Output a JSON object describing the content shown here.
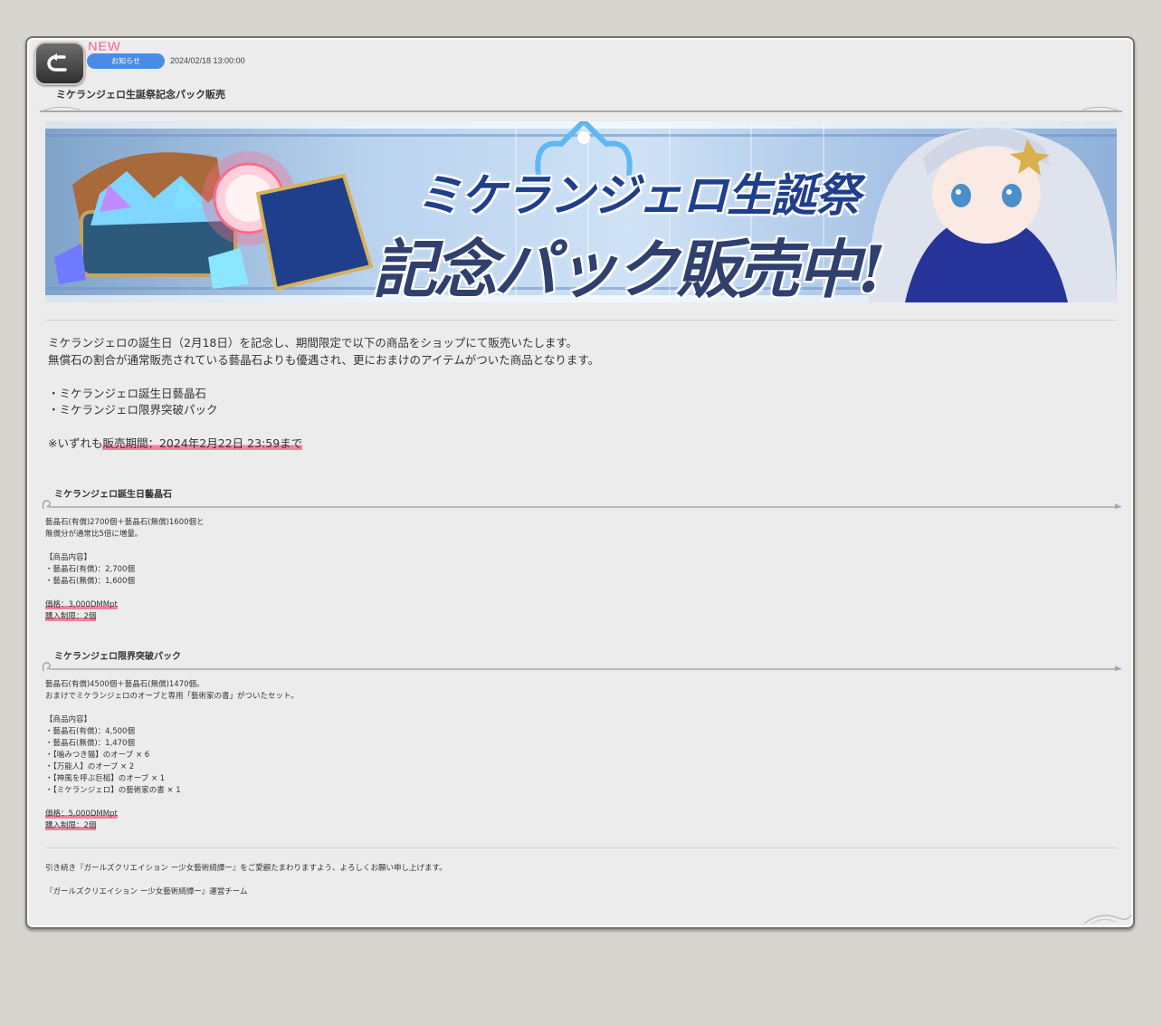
{
  "header": {
    "new_label": "NEW",
    "category": "お知らせ",
    "date": "2024/02/18 13:00:00",
    "title": "ミケランジェロ生誕祭記念パック販売"
  },
  "banner": {
    "line1": "ミケランジェロ生誕祭",
    "line2": "記念パック販売中!"
  },
  "intro": {
    "line1": "ミケランジェロの誕生日（2月18日）を記念し、期間限定で以下の商品をショップにて販売いたします。",
    "line2": "無償石の割合が通常販売されている藝晶石よりも優遇され、更におまけのアイテムがついた商品となります。",
    "items": [
      "・ミケランジェロ誕生日藝晶石",
      "・ミケランジェロ限界突破パック"
    ],
    "note_prefix": "※いずれも",
    "note_highlight": "販売期間：2024年2月22日 23:59まで"
  },
  "sections": [
    {
      "title": "ミケランジェロ誕生日藝晶石",
      "desc": [
        "藝晶石(有償)2700個＋藝晶石(無償)1600個と",
        "無償分が通常比5倍に増量。"
      ],
      "contents_header": "【商品内容】",
      "contents": [
        "・藝晶石(有償)：2,700個",
        "・藝晶石(無償)：1,600個"
      ],
      "price": "価格：3,000DMMpt",
      "limit": "購入制限：2個"
    },
    {
      "title": "ミケランジェロ限界突破パック",
      "desc": [
        "藝晶石(有償)4500個＋藝晶石(無償)1470個。",
        "おまけでミケランジェロのオーブと専用「藝術家の書」がついたセット。"
      ],
      "contents_header": "【商品内容】",
      "contents": [
        "・藝晶石(有償)：4,500個",
        "・藝晶石(無償)：1,470個",
        "・【噛みつき猫】のオーブ × 6",
        "・【万能人】のオーブ × 2",
        "・【神風を呼ぶ巨槌】のオーブ × 1",
        "・【ミケランジェロ】の藝術家の書 × 1"
      ],
      "price": "価格：5,000DMMpt",
      "limit": "購入制限：2個"
    }
  ],
  "footer": {
    "line1": "引き続き『ガールズクリエイション ー少女藝術綺譚ー』をご愛顧たまわりますよう、よろしくお願い申し上げます。",
    "line2": "『ガールズクリエイション ー少女藝術綺譚ー』運営チーム"
  },
  "colors": {
    "badge": "#4b8be6",
    "new": "#f06a90",
    "highlight": "#f5819b",
    "panel": "#ececec",
    "background": "#d6d5d0"
  }
}
